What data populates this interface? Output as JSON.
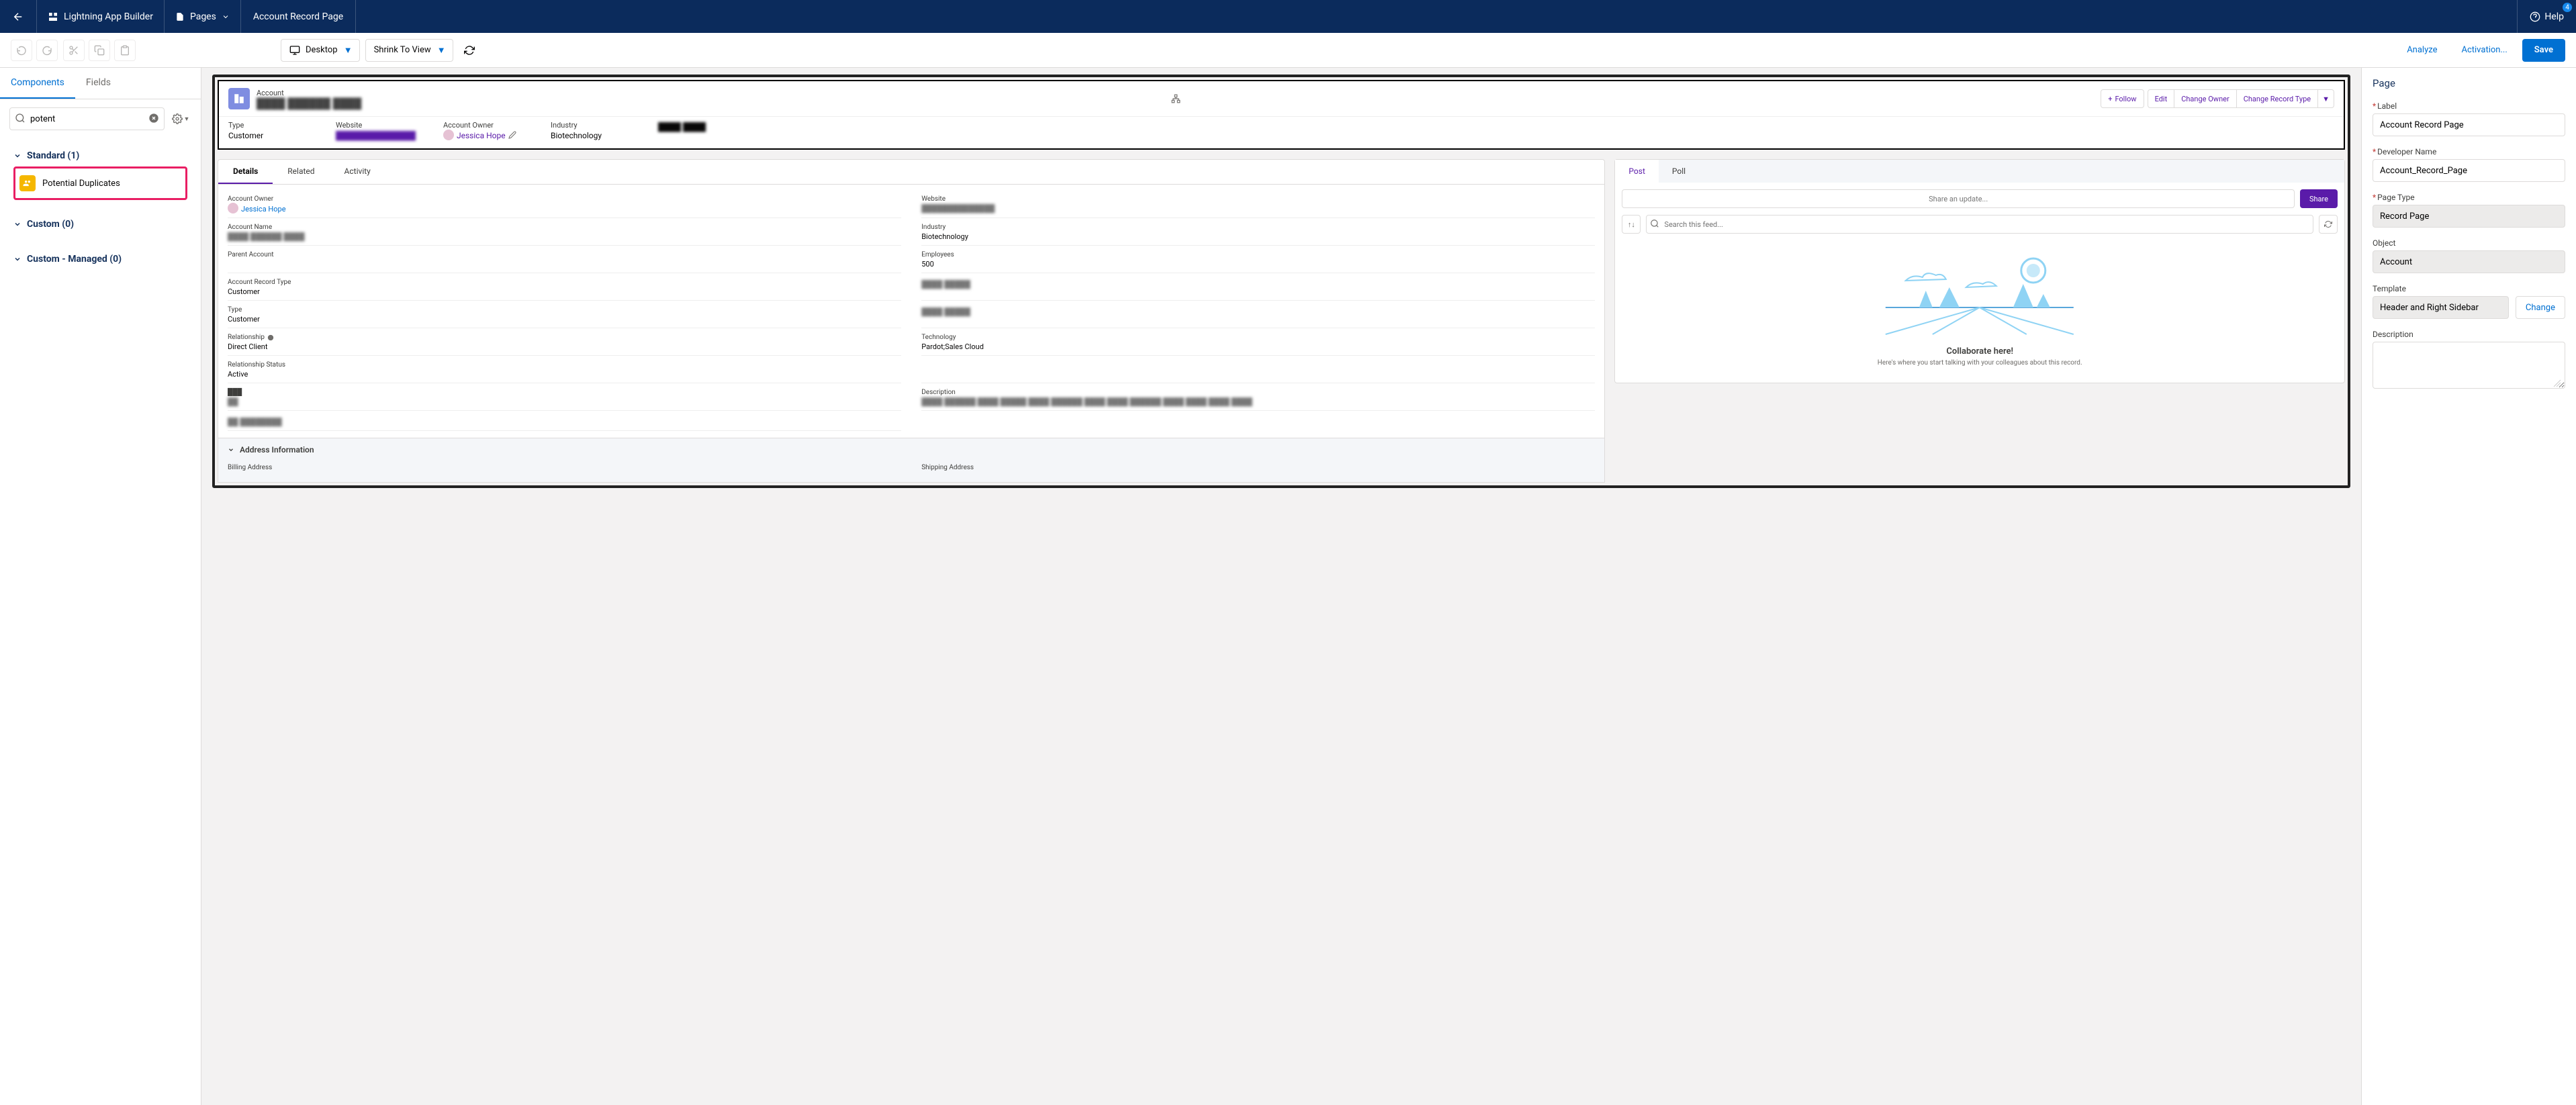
{
  "header": {
    "app_title": "Lightning App Builder",
    "pages_label": "Pages",
    "page_title": "Account Record Page",
    "help_label": "Help",
    "help_badge": "4"
  },
  "toolbar": {
    "viewport_label": "Desktop",
    "zoom_label": "Shrink To View",
    "analyze_label": "Analyze",
    "activation_label": "Activation...",
    "save_label": "Save"
  },
  "left_panel": {
    "tabs": {
      "components": "Components",
      "fields": "Fields"
    },
    "search_value": "potent",
    "sections": [
      {
        "label": "Standard (1)",
        "items": [
          {
            "label": "Potential Duplicates"
          }
        ]
      },
      {
        "label": "Custom (0)",
        "items": []
      },
      {
        "label": "Custom - Managed (0)",
        "items": []
      }
    ]
  },
  "canvas": {
    "record": {
      "object_label": "Account",
      "name_blurred": "████ ██████ ████",
      "actions": {
        "follow": "Follow",
        "edit": "Edit",
        "change_owner": "Change Owner",
        "change_record_type": "Change Record Type"
      },
      "highlight_fields": [
        {
          "label": "Type",
          "value": "Customer"
        },
        {
          "label": "Website",
          "value": "██████████████",
          "blur": true,
          "link": true
        },
        {
          "label": "Account Owner",
          "value": "Jessica Hope",
          "owner": true
        },
        {
          "label": "Industry",
          "value": "Biotechnology"
        },
        {
          "label": "",
          "value": "████ ████",
          "blur": true
        }
      ]
    },
    "tabs": {
      "details": "Details",
      "related": "Related",
      "activity": "Activity"
    },
    "details": {
      "left": [
        {
          "label": "Account Owner",
          "value": "Jessica Hope",
          "owner": true
        },
        {
          "label": "Account Name",
          "value": "████ ██████ ████",
          "blur": true
        },
        {
          "label": "Parent Account",
          "value": ""
        },
        {
          "label": "Account Record Type",
          "value": "Customer"
        },
        {
          "label": "Type",
          "value": "Customer"
        },
        {
          "label": "Relationship",
          "value": "Direct Client",
          "info": true
        },
        {
          "label": "Relationship Status",
          "value": "Active"
        },
        {
          "label": "███",
          "value": "██",
          "blur": true
        },
        {
          "label": "",
          "value": "██ ████████",
          "blur": true
        }
      ],
      "right": [
        {
          "label": "Website",
          "value": "██████████████",
          "blur": true
        },
        {
          "label": "Industry",
          "value": "Biotechnology"
        },
        {
          "label": "Employees",
          "value": "500"
        },
        {
          "label": "",
          "value": "████ █████",
          "blur": true
        },
        {
          "label": "",
          "value": "████ █████",
          "blur": true
        },
        {
          "label": "Technology",
          "value": "Pardot;Sales Cloud"
        },
        {
          "label": "",
          "value": ""
        },
        {
          "label": "Description",
          "value": "████ ██████ ████ █████ ████ ██████ ████ ████ ██████ ████ ████ ████ ████",
          "blur": true
        }
      ],
      "section_label": "Address Information",
      "billing_label": "Billing Address",
      "shipping_label": "Shipping Address"
    },
    "chatter": {
      "tabs": {
        "post": "Post",
        "poll": "Poll"
      },
      "share_placeholder": "Share an update...",
      "share_button": "Share",
      "search_placeholder": "Search this feed...",
      "collab_title": "Collaborate here!",
      "collab_sub": "Here's where you start talking with your colleagues about this record."
    }
  },
  "right_panel": {
    "title": "Page",
    "fields": {
      "label": {
        "label": "Label",
        "value": "Account Record Page",
        "required": true
      },
      "dev_name": {
        "label": "Developer Name",
        "value": "Account_Record_Page",
        "required": true
      },
      "page_type": {
        "label": "Page Type",
        "value": "Record Page",
        "required": true,
        "readonly": true
      },
      "object": {
        "label": "Object",
        "value": "Account",
        "readonly": true
      },
      "template": {
        "label": "Template",
        "value": "Header and Right Sidebar",
        "readonly": true,
        "change": "Change"
      },
      "description": {
        "label": "Description",
        "value": ""
      }
    }
  }
}
